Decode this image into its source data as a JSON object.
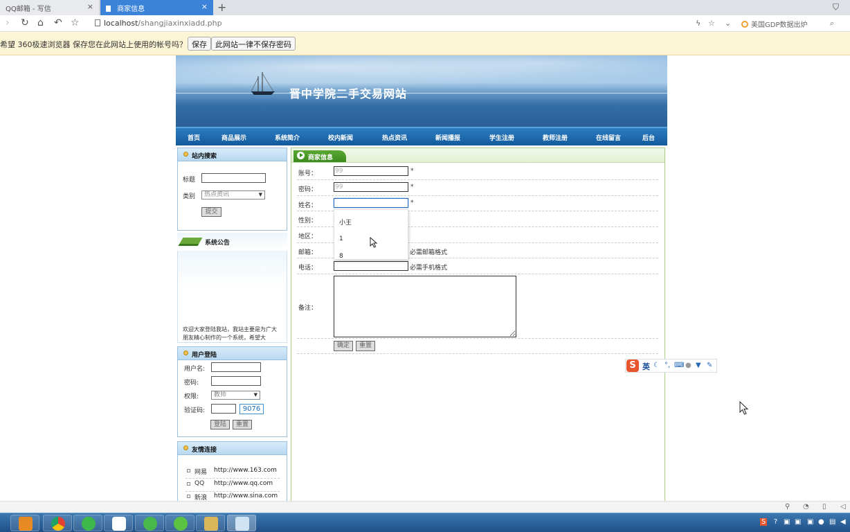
{
  "browser": {
    "tabs": [
      {
        "label": "QQ邮箱 - 写信",
        "close": "×"
      },
      {
        "label": "商家信息",
        "close": "×"
      }
    ],
    "new_tab": "+",
    "url_host": "localhost",
    "url_path": "/shangjiaxinxiadd.php",
    "hot_search": "美国GDP数据出炉"
  },
  "password_bar": {
    "message": "希望 360极速浏览器 保存您在此网站上使用的帐号吗？",
    "save_label": "保存",
    "never_label": "此网站一律不保存密码"
  },
  "site": {
    "title": "晋中学院二手交易网站",
    "nav": [
      "首页",
      "商品展示",
      "系统简介",
      "校内新闻",
      "热点资讯",
      "新闻播报",
      "学生注册",
      "教师注册",
      "在线留言",
      "后台"
    ]
  },
  "search_panel": {
    "heading": "站内搜索",
    "title_label": "标题",
    "category_label": "类别",
    "category_value": "热点资讯",
    "submit_label": "提交"
  },
  "notice_panel": {
    "heading": "系统公告",
    "text": "欢迎大家登陆我站，我站主要是为广大朋友精心制作的一个系统，希望大"
  },
  "login_panel": {
    "heading": "用户登陆",
    "username_label": "用户名:",
    "password_label": "密码:",
    "role_label": "权限:",
    "role_value": "教师",
    "captcha_label": "验证码:",
    "captcha_code": "9076",
    "login_label": "登陆",
    "reset_label": "重置"
  },
  "links_panel": {
    "heading": "友情连接",
    "links": [
      {
        "name": "网易",
        "url": "http://www.163.com"
      },
      {
        "name": "QQ",
        "url": "http://www.qq.com"
      },
      {
        "name": "新浪",
        "url": "http://www.sina.com"
      }
    ]
  },
  "form": {
    "heading": "商家信息",
    "account_label": "账号：",
    "account_value": "99",
    "password_label": "密码：",
    "password_value": "99",
    "name_label": "姓名：",
    "name_value": "",
    "gender_label": "性别：",
    "region_label": "地区：",
    "email_label": "邮箱：",
    "email_hint": "必需邮箱格式",
    "phone_label": "电话：",
    "phone_hint": "必需手机格式",
    "remark_label": "备注：",
    "required_mark": "*",
    "confirm_label": "确定",
    "reset_label": "重置"
  },
  "autocomplete": [
    "小王",
    "1",
    "8"
  ],
  "ime": {
    "logo": "S",
    "mode": "英"
  }
}
